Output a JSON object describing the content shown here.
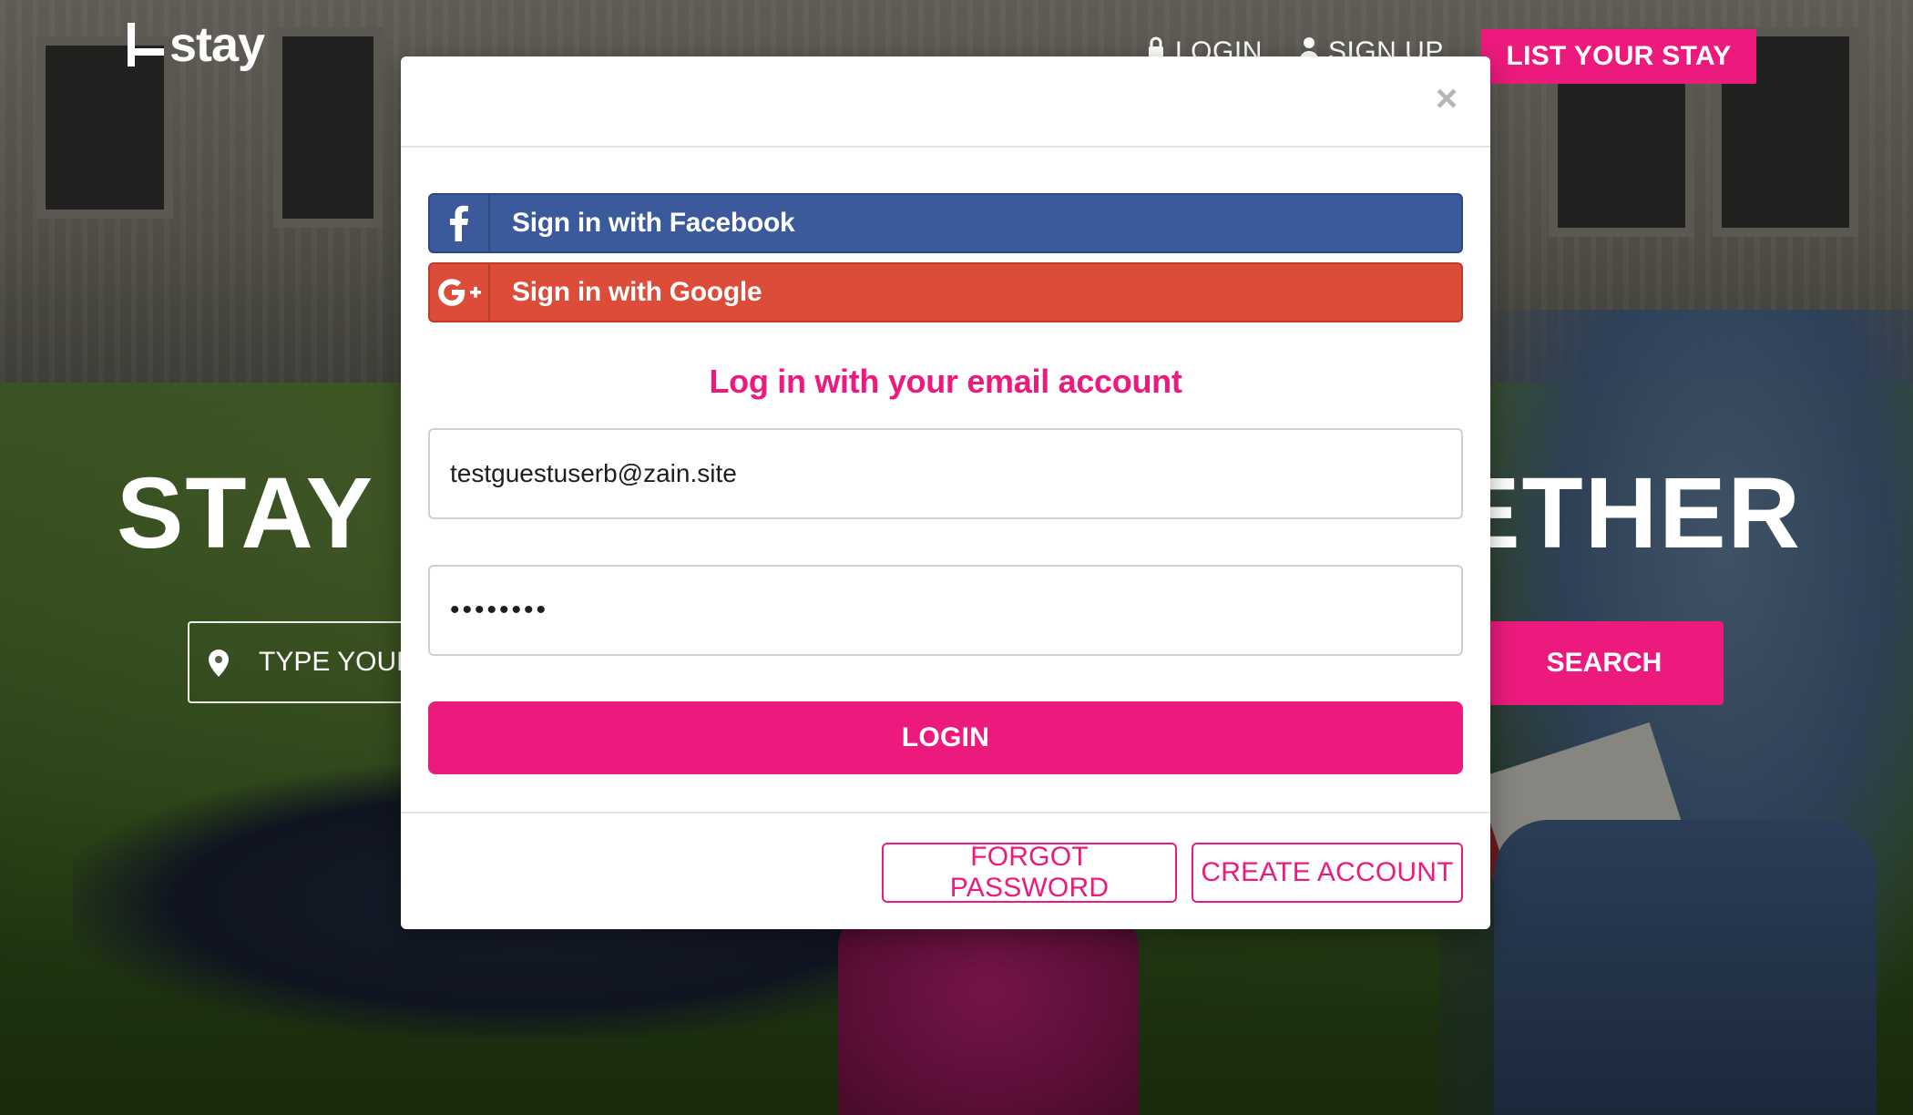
{
  "header": {
    "logo_text": "stay",
    "nav_login": "LOGIN",
    "nav_signup": "SIGN UP",
    "list_stay": "LIST YOUR STAY"
  },
  "hero": {
    "title_left": "STAY T",
    "title_right": "ETHER",
    "search_placeholder": "TYPE YOUR S",
    "search_button": "SEARCH"
  },
  "modal": {
    "close_glyph": "×",
    "facebook_label": "Sign in with Facebook",
    "google_label": "Sign in with Google",
    "email_heading": "Log in with your email account",
    "email_value": "testguestuserb@zain.site",
    "password_value": "••••••••",
    "login_button": "LOGIN",
    "forgot_password": "FORGOT PASSWORD",
    "create_account": "CREATE ACCOUNT"
  },
  "colors": {
    "brand_pink": "#ed1a7d",
    "facebook_blue": "#3b5a9b",
    "google_red": "#dd4b39"
  },
  "icons": {
    "facebook": "facebook-icon",
    "google": "google-plus-icon",
    "close": "close-icon",
    "pin": "map-pin-icon",
    "login": "lock-icon",
    "signup": "user-icon"
  }
}
